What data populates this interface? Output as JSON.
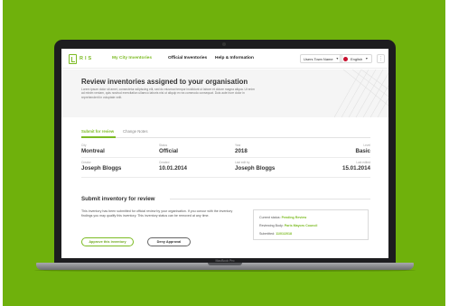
{
  "app": {
    "logo_text": "RIS",
    "nav": {
      "links": [
        "My City Inventories",
        "Official Inventories",
        "Help & Information"
      ],
      "user_select": "Users Town Name",
      "language_select": "English",
      "menu_icon": "more-icon"
    }
  },
  "hero": {
    "title": "Review inventories assigned to your organisation",
    "description": "Lorem ipsum dolor sit amet, consectetur adipiscing elit, sed do eiusmod tempor incididunt ut labore et dolore magna aliqua. Ut enim ad minim veniam, quis nostrud exercitation ullamco laboris nisi ut aliquip ex ea commodo consequat. Duis aute irure dolor in reprehenderit in voluptate velit."
  },
  "tabs": [
    "Submit for review",
    "Change Notes"
  ],
  "fields": {
    "row1": [
      {
        "label": "City",
        "value": "Montreal"
      },
      {
        "label": "Status",
        "value": "Official"
      },
      {
        "label": "Year",
        "value": "2018"
      },
      {
        "label": "Level",
        "value": "Basic"
      }
    ],
    "row2": [
      {
        "label": "Creator",
        "value": "Joseph Bloggs"
      },
      {
        "label": "Created",
        "value": "10.01.2014"
      },
      {
        "label": "Last edit by",
        "value": "Joseph Bloggs"
      },
      {
        "label": "Last edited",
        "value": "15.01.2014"
      }
    ]
  },
  "submit": {
    "title": "Submit inventory for review",
    "description": "This inventory has been submitted for official review by your organisation. If you concur with the inventory findings you may qualify this inventory. This inventory status can be removed at any time.",
    "approve_label": "Approve this inventory",
    "deny_label": "Deny Approval",
    "status": {
      "current_status_label": "Current status:",
      "current_status_value": "Pending Review",
      "reviewing_body_label": "Reviewing Body:",
      "reviewing_body_value": "Paris Mayors Council",
      "submitted_label": "Submitted:",
      "submitted_value": "11/01/2018"
    }
  },
  "device": {
    "model": "MacBook Pro"
  },
  "colors": {
    "background": "#6fb10c",
    "accent": "#7cbb23",
    "laptop_frame": "#1d1d1f"
  }
}
